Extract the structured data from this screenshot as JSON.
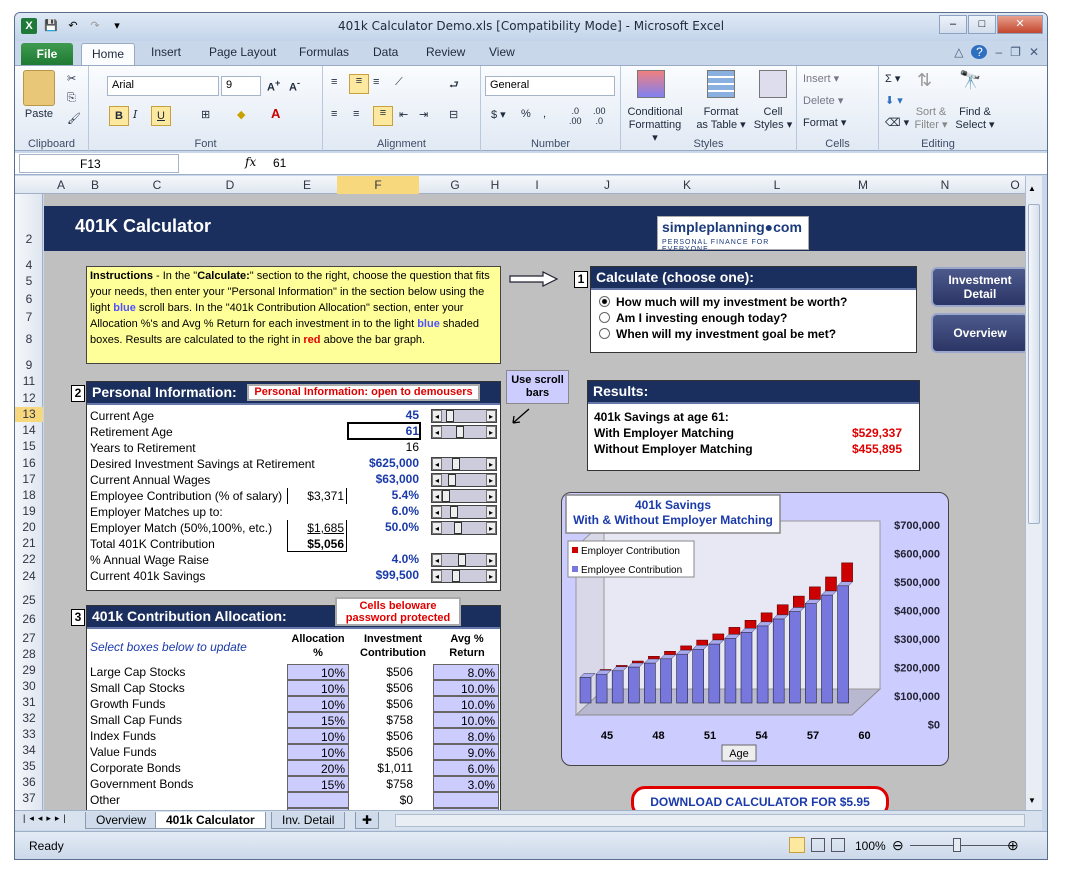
{
  "window": {
    "title": "401k Calculator Demo.xls  [Compatibility Mode]  -  Microsoft Excel"
  },
  "ribbon": {
    "file_tab": "File",
    "tabs": [
      "Home",
      "Insert",
      "Page Layout",
      "Formulas",
      "Data",
      "Review",
      "View"
    ],
    "font_name": "Arial",
    "font_size": "9",
    "number_format": "General",
    "paste": "Paste",
    "groups": {
      "clipboard": "Clipboard",
      "font": "Font",
      "alignment": "Alignment",
      "number": "Number",
      "styles": "Styles",
      "cells": "Cells",
      "editing": "Editing"
    },
    "styles_buttons": [
      {
        "l1": "Conditional",
        "l2": "Formatting ▾"
      },
      {
        "l1": "Format",
        "l2": "as Table ▾"
      },
      {
        "l1": "Cell",
        "l2": "Styles ▾"
      }
    ],
    "cells_buttons": [
      "Insert ▾",
      "Delete ▾",
      "Format ▾"
    ],
    "editing_buttons": [
      {
        "l1": "Sort &",
        "l2": "Filter ▾"
      },
      {
        "l1": "Find &",
        "l2": "Select ▾"
      }
    ]
  },
  "formula_bar": {
    "name_box": "F13",
    "fx": "fx",
    "value": "61"
  },
  "columns": [
    "A",
    "B",
    "C",
    "D",
    "E",
    "F",
    "G",
    "H",
    "I",
    "J",
    "K",
    "L",
    "M",
    "N",
    "O"
  ],
  "rows": [
    "2",
    "4",
    "5",
    "6",
    "7",
    "8",
    "9",
    "11",
    "12",
    "13",
    "14",
    "15",
    "16",
    "17",
    "18",
    "19",
    "20",
    "21",
    "22",
    "24",
    "25",
    "26",
    "27",
    "28",
    "29",
    "30",
    "31",
    "32",
    "33",
    "34",
    "35",
    "36",
    "37"
  ],
  "selected_column": "F",
  "selected_row": "13",
  "sheet": {
    "title": "401K Calculator",
    "logo_line1": "simpleplanning●com",
    "logo_line2": "PERSONAL FINANCE FOR EVERYONE",
    "instructions": {
      "p1": "Instructions",
      "p2": " - In the \"",
      "p3": "Calculate:",
      "p4": "\" section to the right, choose the question that fits your needs, then enter your \"Personal Information\" in the section below using the light ",
      "p5": "blue",
      "p6": " scroll bars.  In the \"401k Contribution Allocation\" section, enter your Allocation %'s and Avg % Return for each investment in to the light ",
      "p7": "blue",
      "p8": " shaded boxes.  Results are calculated to the right in ",
      "p9": "red",
      "p10": " above the bar graph."
    },
    "calc": {
      "num": "1",
      "header": "Calculate (choose one):",
      "options": [
        "How much  will my investment be worth?",
        "Am I investing enough today?",
        "When will my investment goal be met?"
      ],
      "selected": 0
    },
    "nav": {
      "investment_detail": "Investment Detail",
      "overview": "Overview"
    },
    "use_scroll": "Use scroll bars",
    "personal": {
      "num": "2",
      "header": "Personal Information:",
      "note": "Personal Information: open to demousers",
      "rows": [
        {
          "label": "Current Age",
          "value": "45"
        },
        {
          "label": "Retirement Age",
          "value": "61"
        },
        {
          "label": "Years to Retirement",
          "value": "16"
        },
        {
          "label": "Desired Investment Savings at Retirement",
          "value": "$625,000"
        },
        {
          "label": "Current Annual Wages",
          "value": "$63,000"
        },
        {
          "label": "Employee Contribution (% of salary)",
          "value": "5.4%",
          "box": "$3,371"
        },
        {
          "label": "Employer Matches up to:",
          "value": "6.0%"
        },
        {
          "label": "Employer Match (50%,100%, etc.)",
          "value": "50.0%",
          "box": "$1,685"
        },
        {
          "label": "Total 401K Contribution",
          "value": "",
          "box": "$5,056"
        },
        {
          "label": "% Annual Wage Raise",
          "value": "4.0%"
        },
        {
          "label": "Current 401k Savings",
          "value": "$99,500"
        }
      ]
    },
    "results": {
      "header": "Results:",
      "line1": "401k Savings at age 61:",
      "with_label": "With Employer Matching",
      "with_value": "$529,337",
      "without_label": "Without Employer Matching",
      "without_value": "$455,895"
    },
    "alloc": {
      "num": "3",
      "header": "401k Contribution Allocation:",
      "note": "Cells beloware password protected",
      "hint": "Select boxes below to update",
      "col_alloc": "Allocation %",
      "col_contrib": "Investment Contribution",
      "col_return": "Avg % Return",
      "rows": [
        {
          "name": "Large Cap Stocks",
          "alloc": "10%",
          "contrib": "$506",
          "ret": "8.0%"
        },
        {
          "name": "Small Cap Stocks",
          "alloc": "10%",
          "contrib": "$506",
          "ret": "10.0%"
        },
        {
          "name": "Growth Funds",
          "alloc": "10%",
          "contrib": "$506",
          "ret": "10.0%"
        },
        {
          "name": "Small Cap Funds",
          "alloc": "15%",
          "contrib": "$758",
          "ret": "10.0%"
        },
        {
          "name": "Index Funds",
          "alloc": "10%",
          "contrib": "$506",
          "ret": "8.0%"
        },
        {
          "name": "Value Funds",
          "alloc": "10%",
          "contrib": "$506",
          "ret": "9.0%"
        },
        {
          "name": "Corporate Bonds",
          "alloc": "20%",
          "contrib": "$1,011",
          "ret": "6.0%"
        },
        {
          "name": "Government Bonds",
          "alloc": "15%",
          "contrib": "$758",
          "ret": "3.0%"
        },
        {
          "name": "Other",
          "alloc": "",
          "contrib": "$0",
          "ret": ""
        },
        {
          "name": "Other",
          "alloc": "",
          "contrib": "$0",
          "ret": ""
        }
      ]
    },
    "download": "DOWNLOAD CALCULATOR FOR $5.95"
  },
  "chart_data": {
    "type": "bar",
    "title": "401k  Savings",
    "subtitle": "With & Without Employer  Matching",
    "xlabel": "Age",
    "x": [
      45,
      46,
      47,
      48,
      49,
      50,
      51,
      52,
      53,
      54,
      55,
      56,
      57,
      58,
      59,
      60,
      61
    ],
    "xticks": [
      "45",
      "48",
      "51",
      "54",
      "57",
      "60"
    ],
    "yticks": [
      "$700,000",
      "$600,000",
      "$500,000",
      "$400,000",
      "$300,000",
      "$200,000",
      "$100,000",
      "$0"
    ],
    "ylim": [
      0,
      700000
    ],
    "series": [
      {
        "name": "Employee Contribution",
        "color": "#7777dd",
        "values": [
          99500,
          112000,
          125500,
          140000,
          155500,
          172000,
          190000,
          209000,
          229500,
          251500,
          275000,
          300000,
          327000,
          356000,
          387000,
          420000,
          455895
        ]
      },
      {
        "name": "Employer Contribution",
        "color": "#cc0000",
        "values": [
          99500,
          114500,
          130500,
          147500,
          166000,
          185500,
          206500,
          229000,
          253000,
          278500,
          306000,
          335000,
          366500,
          400000,
          436000,
          474500,
          529337
        ]
      }
    ],
    "legend": "top-left"
  },
  "sheet_tabs": [
    "Overview",
    "401k Calculator",
    "Inv. Detail"
  ],
  "active_sheet": 1,
  "status": {
    "ready": "Ready",
    "zoom": "100%"
  }
}
